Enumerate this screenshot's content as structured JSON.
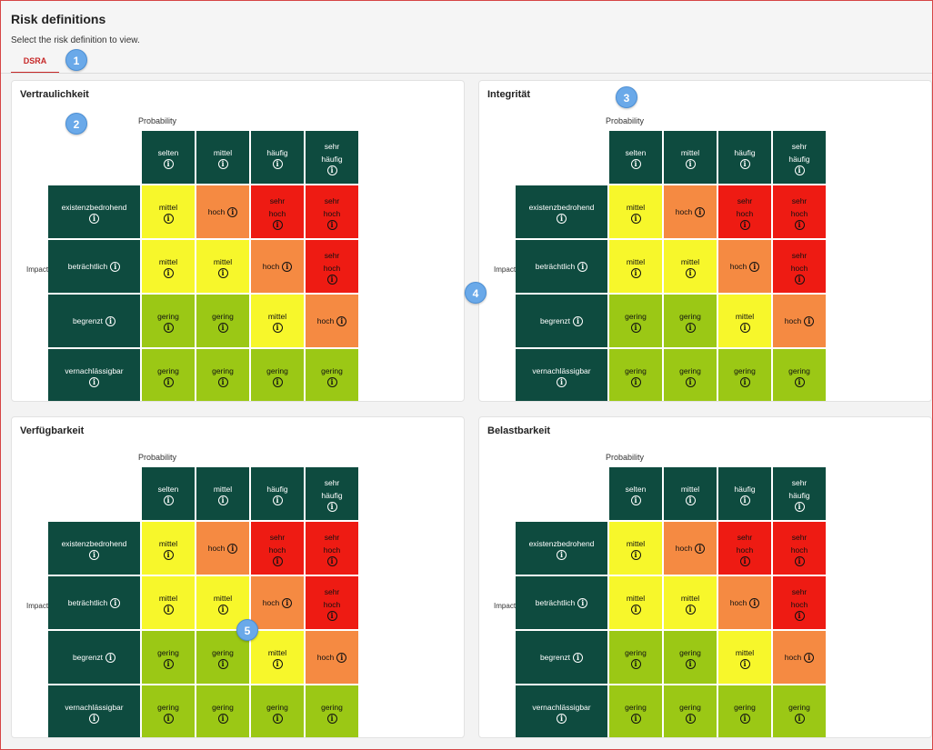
{
  "page": {
    "title": "Risk definitions",
    "subtitle": "Select the risk definition to view.",
    "tab_label": "DSRA"
  },
  "markers": [
    "1",
    "2",
    "3",
    "4",
    "5"
  ],
  "matrix": {
    "probability_label": "Probability",
    "impact_label": [
      "I",
      "m",
      "p",
      "a",
      "c",
      "t"
    ],
    "columns": [
      "selten",
      "mittel",
      "häufig",
      "sehr häufig"
    ],
    "rows": [
      "existenzbedrohend",
      "beträchtlich",
      "begrenzt",
      "vernachlässigbar"
    ],
    "cells": [
      [
        "mittel",
        "hoch",
        "sehr hoch",
        "sehr hoch"
      ],
      [
        "mittel",
        "mittel",
        "hoch",
        "sehr hoch"
      ],
      [
        "gering",
        "gering",
        "mittel",
        "hoch"
      ],
      [
        "gering",
        "gering",
        "gering",
        "gering"
      ]
    ],
    "info_icon": "info-icon"
  },
  "level_colors": {
    "gering": "#9bc815",
    "mittel": "#f7f72b",
    "hoch": "#f58a42",
    "sehr hoch": "#ee1b13",
    "header": "#0e4b3f"
  },
  "panels": [
    {
      "title": "Vertraulichkeit"
    },
    {
      "title": "Integrität"
    },
    {
      "title": "Verfügbarkeit"
    },
    {
      "title": "Belastbarkeit"
    }
  ]
}
